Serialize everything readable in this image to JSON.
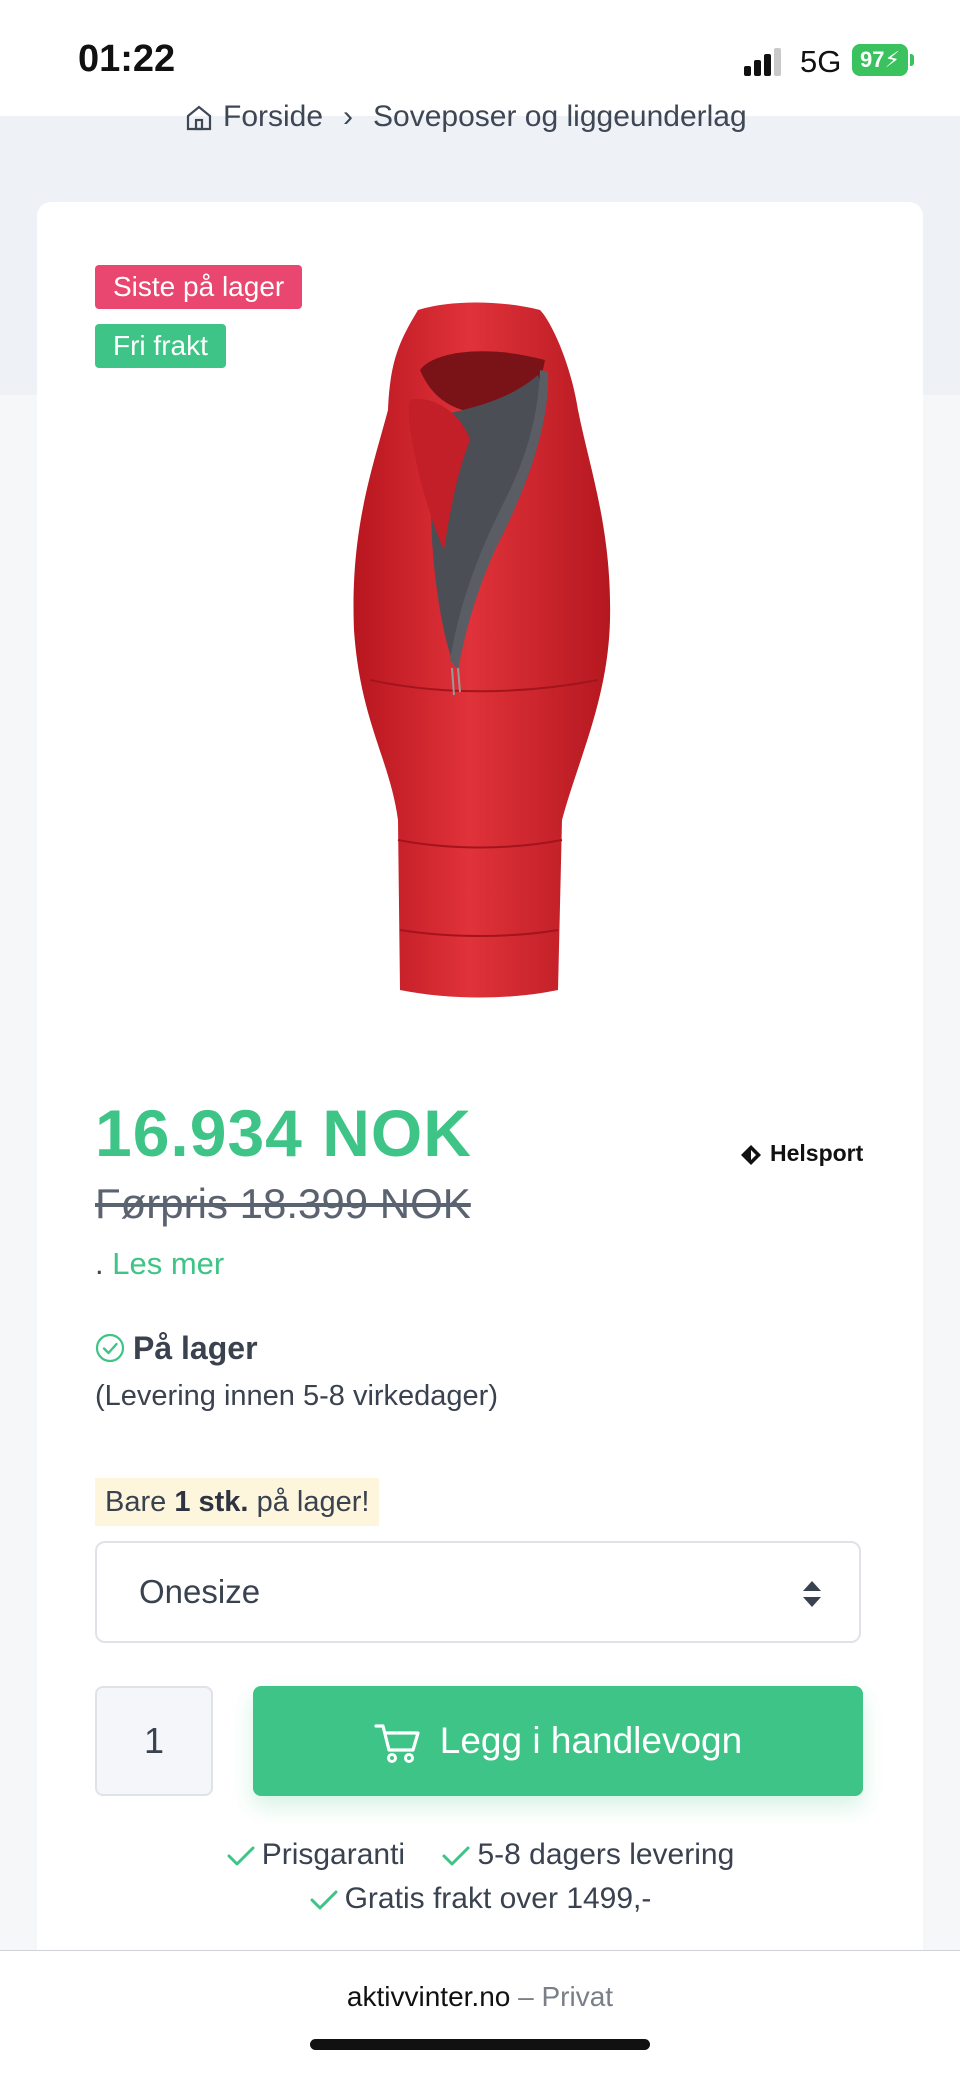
{
  "status_bar": {
    "time": "01:22",
    "network": "5G",
    "battery": "97"
  },
  "breadcrumb": {
    "home": "Forside",
    "category": "Soveposer og liggeunderlag"
  },
  "product": {
    "badges": {
      "stock": "Siste på lager",
      "shipping": "Fri frakt"
    },
    "price": "16.934 NOK",
    "old_price": "Førpris 18.399 NOK",
    "read_more_prefix": ".",
    "read_more": "Les mer",
    "brand": "Helsport",
    "stock_status": "På lager",
    "delivery": "(Levering innen 5-8 virkedager)",
    "only_left": {
      "prefix": "Bare",
      "count": "1 stk.",
      "suffix": "på lager!"
    },
    "size": "Onesize",
    "quantity": "1",
    "add_to_cart": "Legg i handlevogn"
  },
  "usps": {
    "price_guarantee": "Prisgaranti",
    "delivery": "5-8 dagers levering",
    "free_shipping": "Gratis frakt over 1499,-"
  },
  "browser": {
    "url": "aktivvinter.no",
    "mode": "– Privat"
  },
  "colors": {
    "accent_green": "#3ec486",
    "badge_red": "#e9476f",
    "product_red": "#d8262d"
  }
}
